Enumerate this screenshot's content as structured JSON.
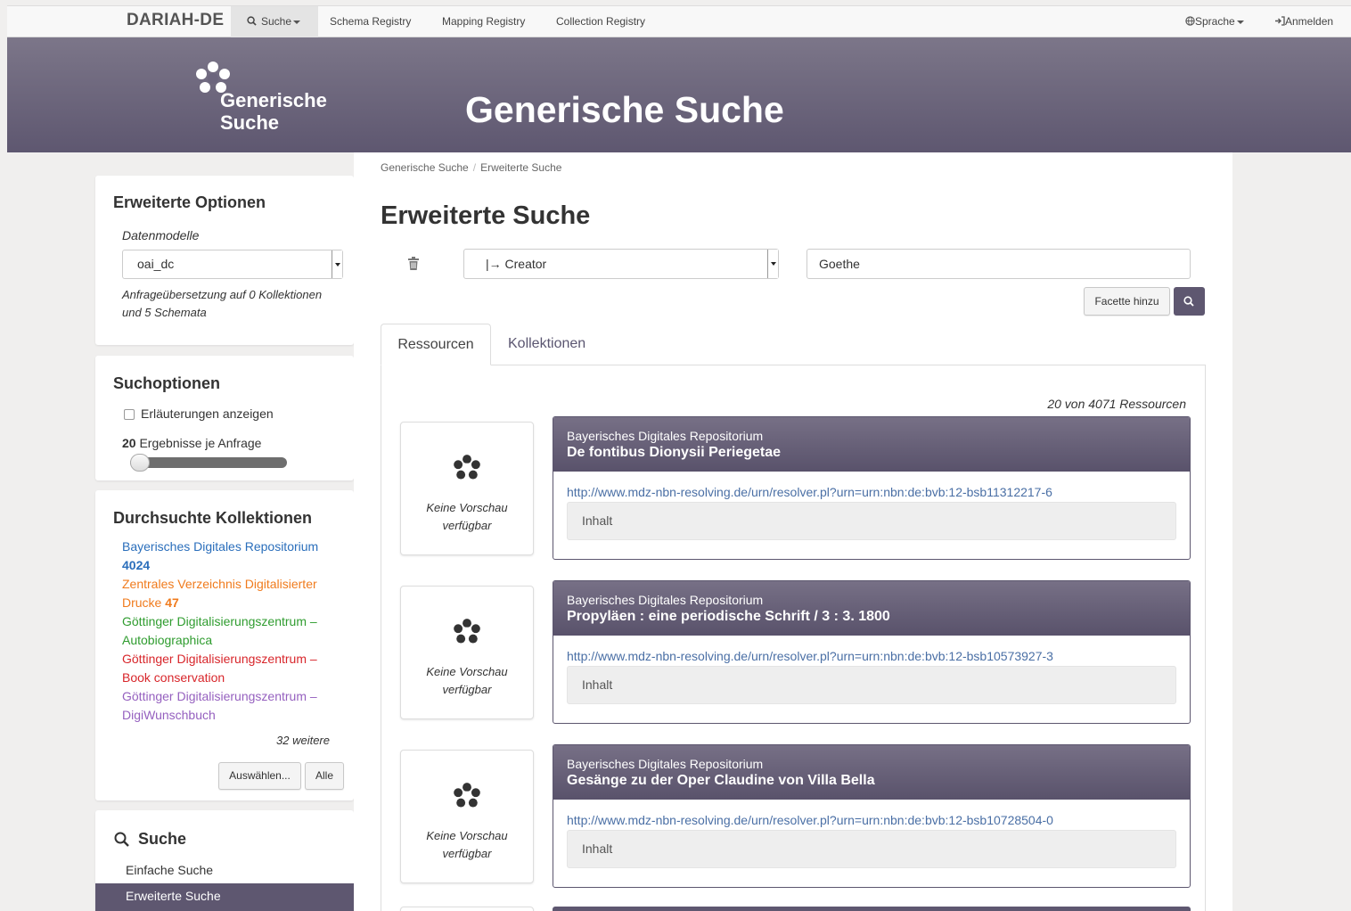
{
  "nav": {
    "brand": "DARIAH-DE",
    "search": "Suche",
    "items": [
      "Schema Registry",
      "Mapping Registry",
      "Collection Registry"
    ],
    "language": "Sprache",
    "login": "Anmelden"
  },
  "banner": {
    "logo_line1": "Generische",
    "logo_line2": "Suche",
    "title": "Generische Suche"
  },
  "options": {
    "heading": "Erweiterte Optionen",
    "models_label": "Datenmodelle",
    "model_value": "oai_dc",
    "note_line1": "Anfrageübersetzung auf 0 Kollektionen",
    "note_line2": "und 5 Schemata"
  },
  "search_options": {
    "heading": "Suchoptionen",
    "checkbox_label": "Erläuterungen anzeigen",
    "results_count": "20",
    "results_label": "Ergebnisse je Anfrage",
    "slider_fraction": 0.0
  },
  "collections": {
    "heading": "Durchsuchte Kollektionen",
    "items": [
      {
        "l1": "Bayerisches Digitales Repositorium",
        "l2": "4024",
        "color": "#2a6ebb"
      },
      {
        "l1": "Zentrales Verzeichnis Digitalisierter",
        "l2": "Drucke",
        "count": "47",
        "color": "#f07b1d"
      },
      {
        "l1": "Göttinger Digitalisierungszentrum –",
        "l2": "Autobiographica",
        "color": "#2f9c2f"
      },
      {
        "l1": "Göttinger Digitalisierungszentrum –",
        "l2": "Book conservation",
        "color": "#d8262b"
      },
      {
        "l1": "Göttinger Digitalisierungszentrum –",
        "l2": "DigiWunschbuch",
        "color": "#9560bf"
      }
    ],
    "more": "32 weitere",
    "select_button": "Auswählen...",
    "all_button": "Alle"
  },
  "search_nav": {
    "heading": "Suche",
    "simple": "Einfache Suche",
    "advanced": "Erweiterte Suche"
  },
  "breadcrumb": {
    "root": "Generische Suche",
    "sep": "/",
    "current": "Erweiterte Suche"
  },
  "page_title": "Erweiterte Suche",
  "query": {
    "field": "|→ Creator",
    "value": "Goethe",
    "add_facet": "Facette hinzu"
  },
  "tabs": {
    "resources": "Ressourcen",
    "collections": "Kollektionen"
  },
  "results_summary": "20 von 4071 Ressourcen",
  "no_preview_line1": "Keine Vorschau",
  "no_preview_line2": "verfügbar",
  "results": [
    {
      "repo": "Bayerisches Digitales Repositorium",
      "title": "De fontibus Dionysii Periegetae",
      "url": "http://www.mdz-nbn-resolving.de/urn/resolver.pl?urn=urn:nbn:de:bvb:12-bsb11312217-6",
      "content": "Inhalt"
    },
    {
      "repo": "Bayerisches Digitales Repositorium",
      "title": "Propyläen : eine periodische Schrift / 3 : 3. 1800",
      "url": "http://www.mdz-nbn-resolving.de/urn/resolver.pl?urn=urn:nbn:de:bvb:12-bsb10573927-3",
      "content": "Inhalt"
    },
    {
      "repo": "Bayerisches Digitales Repositorium",
      "title": "Gesänge zu der Oper Claudine von Villa Bella",
      "url": "http://www.mdz-nbn-resolving.de/urn/resolver.pl?urn=urn:nbn:de:bvb:12-bsb10728504-0",
      "content": "Inhalt"
    }
  ]
}
